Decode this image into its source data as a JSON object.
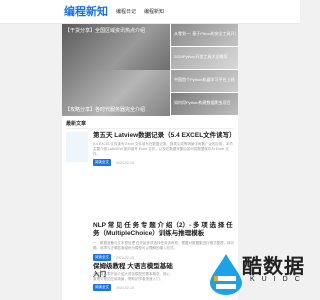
{
  "header": {
    "logo": "编程新知",
    "nav": [
      "编程日记",
      "编程新知"
    ]
  },
  "hero": {
    "main_top_caption": "【干货分享】全国区域资讯热点介绍",
    "main_bottom_caption": "【攻略分享】各时代服务器完全介绍",
    "side": [
      "从零到一: 基于Pthon的安全工具开发",
      "2024Python开发工具大全推荐",
      "中国首个Python机器学习平台上线",
      "如何用Python构建数据爬虫项目"
    ]
  },
  "main": {
    "section_title": "最新文章",
    "posts": [
      {
        "title": "第五天 Latview数据记录（5.4 EXCEL文件读写）",
        "excerpt": "5.4 EXCEL文件读写 Excel 文件读写在数据记录、报表生成等场景中有着广泛的应用。本节主要介绍 LabVIEW 如何读写 Excel 文件，以及在数据采集后如何将数据保存为 Excel 文件。",
        "more": "阅读全文",
        "date": "2024-02-15"
      },
      {
        "title": "NLP 常 见 任 务 专 题 介 绍（2）- 多 项 选 择 任 务（MultipleChoice）训练与推理模板",
        "excerpt": "一、数据准备与文本预处理 在开始多项选择任务训练前，需要对数据集进行格式整理，将问题、选项与正确答案组织为模型可以理解的输入形式。",
        "more": "阅读全文",
        "date": "2024-02-15"
      },
      {
        "title": "保姆级教程 大语言模型基础入门",
        "excerpt": "本文将从零开始介绍大语言模型的基本概念、核心原理与常见应用场景，帮助初学者快速入门。",
        "more": "阅读全文",
        "date": "2024-02-15"
      }
    ]
  },
  "watermark": {
    "text": "酷数据",
    "sub": "KUIDC"
  }
}
